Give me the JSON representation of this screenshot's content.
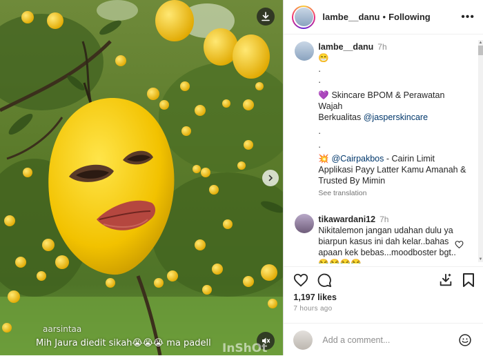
{
  "media": {
    "caption_line1": "aarsintaa",
    "caption_line2": "Mih Jaura diedit sikah😭😭😭 ma padell",
    "watermark": "InShOt"
  },
  "header": {
    "username": "lambe__danu",
    "dot": "•",
    "follow_status": "Following",
    "more": "•••"
  },
  "caption": {
    "username": "lambe__danu",
    "time": "7h",
    "lines": [
      "😁",
      ".",
      ".",
      "💜 Skincare BPOM & Perawatan Wajah",
      "Berkualitas",
      ".",
      ".",
      "💥",
      "Applikasi Payy Latter Kamu Amanah &",
      "Trusted By Mimin"
    ],
    "mention1": "@jasperskincare",
    "mention2": "@Cairpakbos",
    "mention2_suffix": " - Cairin Limit",
    "see_translation": "See translation"
  },
  "comment": {
    "username": "tikawardani12",
    "time": "7h",
    "text": "Nikitalemon jangan udahan dulu ya biarpun kasus ini dah kelar..bahas apaan kek bebas...moodboster bgt.. 😂😂😂😂"
  },
  "engagement": {
    "likes": "1,197 likes",
    "ago": "7 hours ago"
  },
  "add_comment": {
    "placeholder": "Add a comment..."
  }
}
